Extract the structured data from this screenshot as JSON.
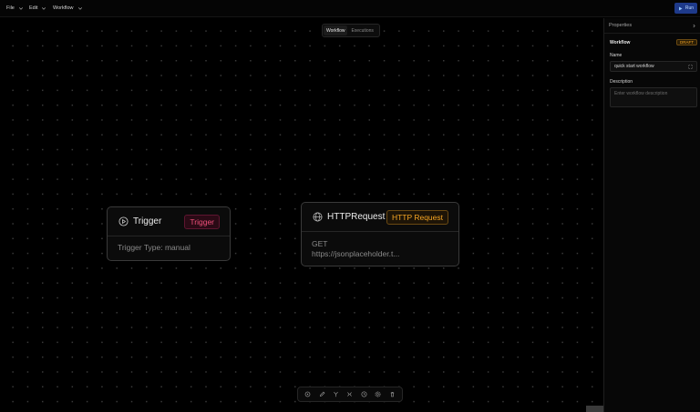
{
  "menubar": {
    "menus": [
      {
        "label": "File"
      },
      {
        "label": "Edit"
      },
      {
        "label": "Workflow"
      }
    ],
    "run_label": "Run"
  },
  "canvas": {
    "tabs": [
      {
        "label": "Workflow",
        "active": true
      },
      {
        "label": "Executions",
        "active": false
      }
    ],
    "nodes": {
      "trigger": {
        "title": "Trigger",
        "badge": "Trigger",
        "detail": "Trigger Type: manual",
        "icon": "play-circle-icon"
      },
      "http": {
        "title": "HTTPRequest",
        "badge": "HTTP Request",
        "method": "GET",
        "url": "https://jsonplaceholder.t...",
        "icon": "globe-icon"
      }
    },
    "toolbar": [
      {
        "icon": "select-icon"
      },
      {
        "icon": "pen-icon"
      },
      {
        "icon": "branch-icon"
      },
      {
        "icon": "fit-view-icon"
      },
      {
        "icon": "history-icon"
      },
      {
        "icon": "settings-icon"
      },
      {
        "icon": "trash-icon"
      }
    ]
  },
  "properties": {
    "header": "Properties",
    "section_title": "Workflow",
    "status_badge": "DRAFT",
    "name_label": "Name",
    "name_value": "quick start workflow",
    "description_label": "Description",
    "description_placeholder": "Enter workflow description"
  },
  "colors": {
    "background": "#000000",
    "trigger_accent": "#f0507a",
    "http_accent": "#f5a524",
    "run_button": "#1e3a8a"
  }
}
